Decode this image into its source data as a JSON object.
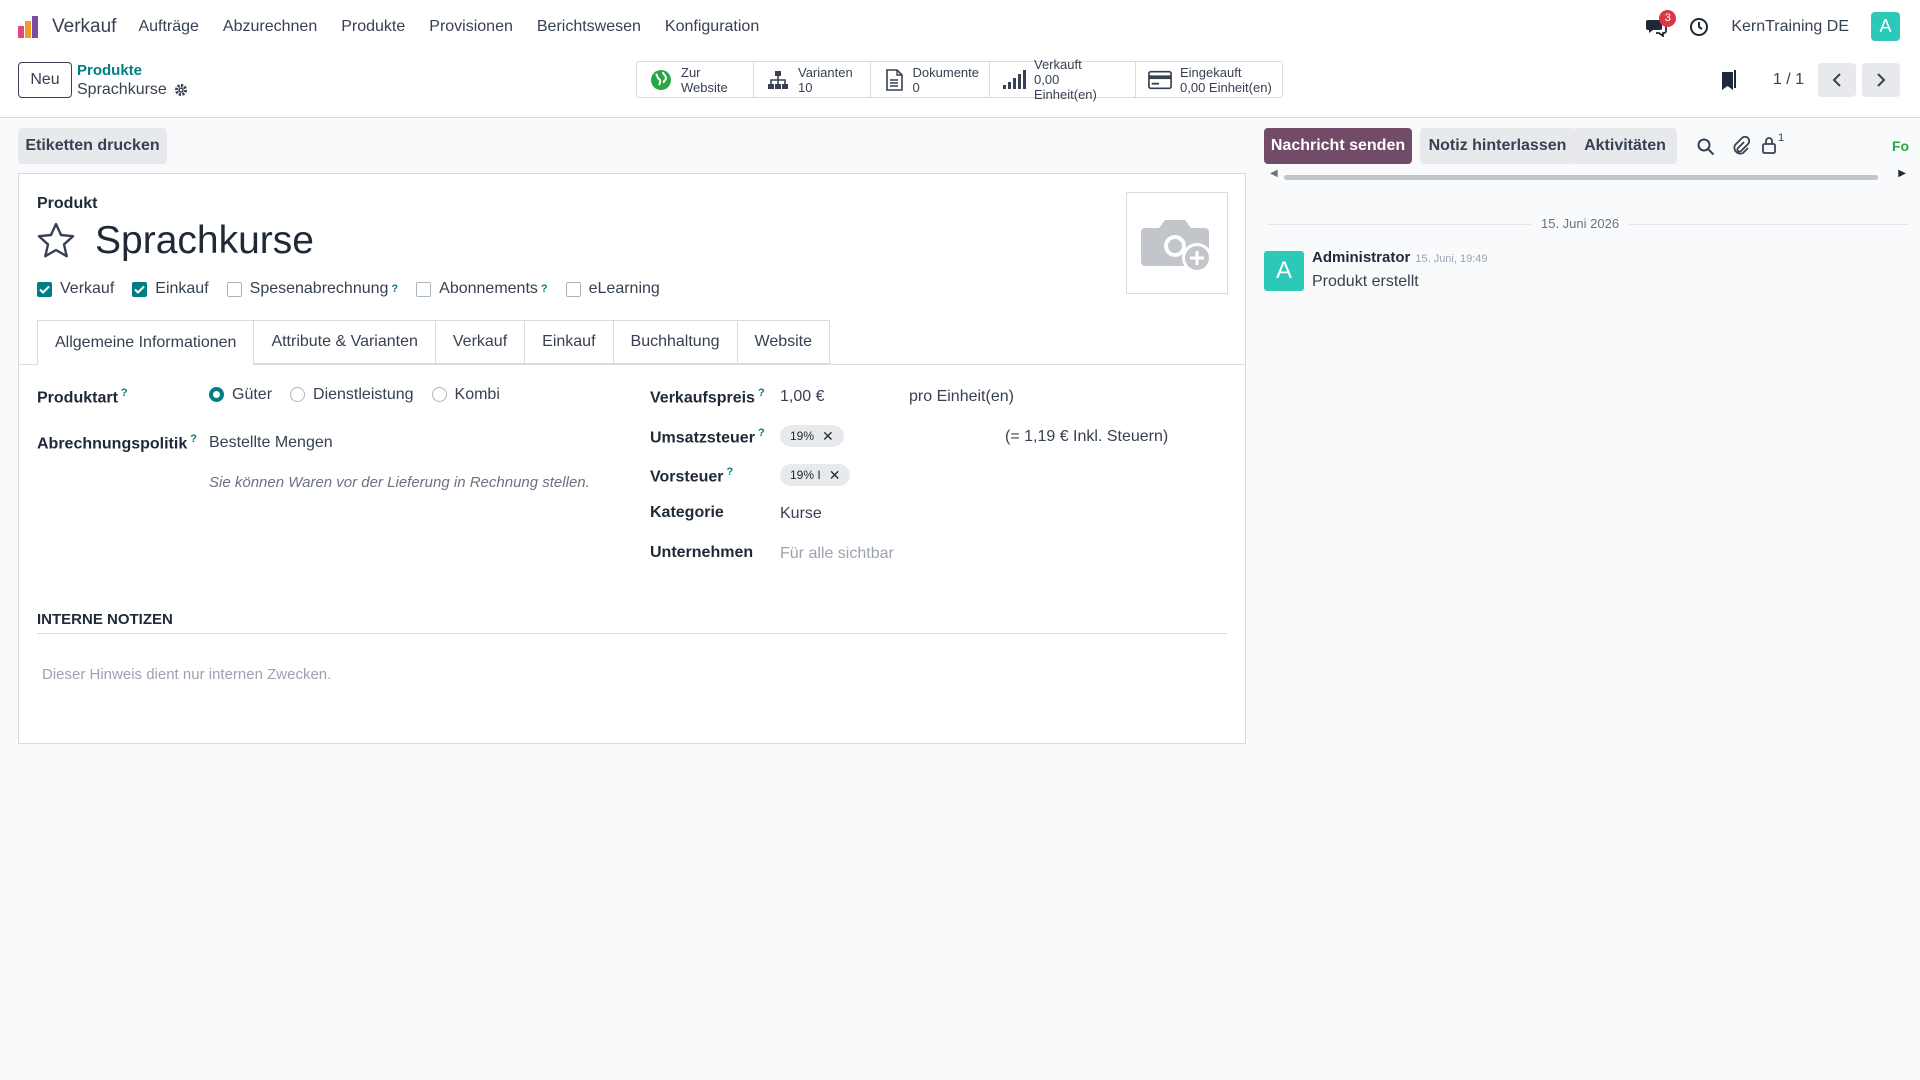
{
  "nav": {
    "app_name": "Verkauf",
    "menu": [
      "Aufträge",
      "Abzurechnen",
      "Produkte",
      "Provisionen",
      "Berichtswesen",
      "Konfiguration"
    ],
    "messages_badge": "3",
    "company": "KernTraining DE",
    "user_initial": "A"
  },
  "control": {
    "new_label": "Neu",
    "breadcrumb_parent": "Produkte",
    "breadcrumb_current": "Sprachkurse",
    "stats": [
      {
        "label": "Zur",
        "value": "Website",
        "icon": "globe-icon"
      },
      {
        "label": "Varianten",
        "value": "10",
        "icon": "sitemap-icon"
      },
      {
        "label": "Dokumente",
        "value": "0",
        "icon": "document-icon"
      },
      {
        "label": "Verkauft",
        "value": "0,00 Einheit(en)",
        "icon": "signal-icon"
      },
      {
        "label": "Eingekauft",
        "value": "0,00 Einheit(en)",
        "icon": "credit-card-icon"
      }
    ],
    "pager": "1 / 1"
  },
  "actions": {
    "print_labels": "Etiketten drucken"
  },
  "form": {
    "product_label": "Produkt",
    "product_name": "Sprachkurse",
    "options": [
      {
        "label": "Verkauf",
        "checked": true,
        "hint": false
      },
      {
        "label": "Einkauf",
        "checked": true,
        "hint": false
      },
      {
        "label": "Spesenabrechnung",
        "checked": false,
        "hint": true
      },
      {
        "label": "Abonnements",
        "checked": false,
        "hint": true
      },
      {
        "label": "eLearning",
        "checked": false,
        "hint": false
      }
    ],
    "tabs": [
      "Allgemeine Informationen",
      "Attribute & Varianten",
      "Verkauf",
      "Einkauf",
      "Buchhaltung",
      "Website"
    ],
    "product_type_label": "Produktart",
    "product_types": [
      "Güter",
      "Dienstleistung",
      "Kombi"
    ],
    "invoice_policy_label": "Abrechnungspolitik",
    "invoice_policy_value": "Bestellte Mengen",
    "invoice_policy_help": "Sie können Waren vor der Lieferung in Rechnung stellen.",
    "sales_price_label": "Verkaufspreis",
    "sales_price_value": "1,00 €",
    "sales_price_unit": "pro Einheit(en)",
    "sales_tax_label": "Umsatzsteuer",
    "sales_tax_tag": "19%",
    "sales_tax_incl": "(= 1,19 € Inkl. Steuern)",
    "purchase_tax_label": "Vorsteuer",
    "purchase_tax_tag": "19% I",
    "category_label": "Kategorie",
    "category_value": "Kurse",
    "company_label": "Unternehmen",
    "company_placeholder": "Für alle sichtbar",
    "notes_title": "INTERNE NOTIZEN",
    "notes_placeholder": "Dieser Hinweis dient nur internen Zwecken."
  },
  "chatter": {
    "send_message": "Nachricht senden",
    "log_note": "Notiz hinterlassen",
    "activities": "Aktivitäten",
    "followers_count": "1",
    "follow_label": "Fo",
    "date_separator": "15. Juni 2026",
    "message": {
      "author": "Administrator",
      "time": "15. Juni, 19:49",
      "body": "Produkt erstellt",
      "initial": "A"
    }
  },
  "colors": {
    "primary": "#714b67",
    "accent": "#017e84",
    "avatar": "#2dc9b8",
    "badge": "#dc3545"
  }
}
